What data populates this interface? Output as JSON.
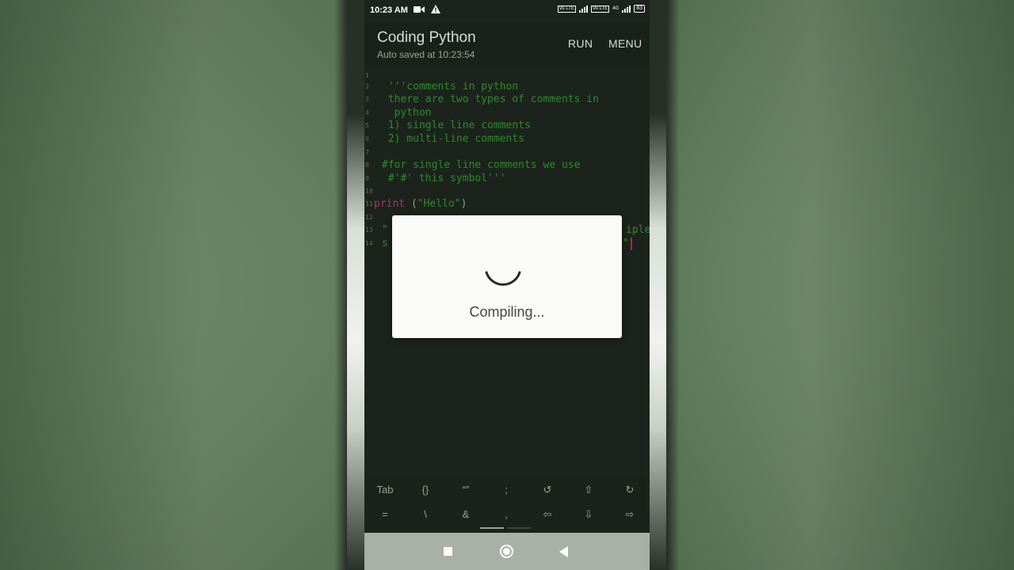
{
  "status": {
    "time": "10:23 AM",
    "battery": "83",
    "volte1": "Vo LTE",
    "volte2": "Vo LTE",
    "net": "4G"
  },
  "appbar": {
    "title": "Coding Python",
    "subtitle": "Auto saved at 10:23:54",
    "run_label": "RUN",
    "menu_label": "MENU"
  },
  "editor": {
    "line_numbers": [
      "1",
      "2",
      "3",
      "4",
      "5",
      "6",
      "7",
      "8",
      "9",
      "10",
      "11",
      "12",
      "13",
      "14"
    ],
    "lines": {
      "l2": " '''comments in python",
      "l3": " there are two types of comments in",
      "l4": "  python",
      "l5": " 1) single line comments",
      "l6": " 2) multi-line comments",
      "l8": "#for single line comments we use",
      "l9": " #'#' this symbol'''",
      "l11_kw": "print",
      "l11_open": " (",
      "l11_str": "\"Hello\"",
      "l11_close": ")",
      "l13_left": "\"",
      "l13_right": "iple",
      "l14_left": "s",
      "l14_right": "\""
    }
  },
  "dialog": {
    "message": "Compiling..."
  },
  "keys": {
    "row1": [
      "Tab",
      "{}",
      "“”",
      ";",
      "↺",
      "⇧",
      "↻"
    ],
    "row2": [
      "=",
      "\\",
      "&",
      ",",
      "⇦",
      "⇩",
      "⇨"
    ]
  },
  "colors": {
    "editor_bg": "#1c231c",
    "comment_green": "#2d8a2d",
    "keyword_pink": "#b0306a",
    "cursor": "#c2185b"
  }
}
